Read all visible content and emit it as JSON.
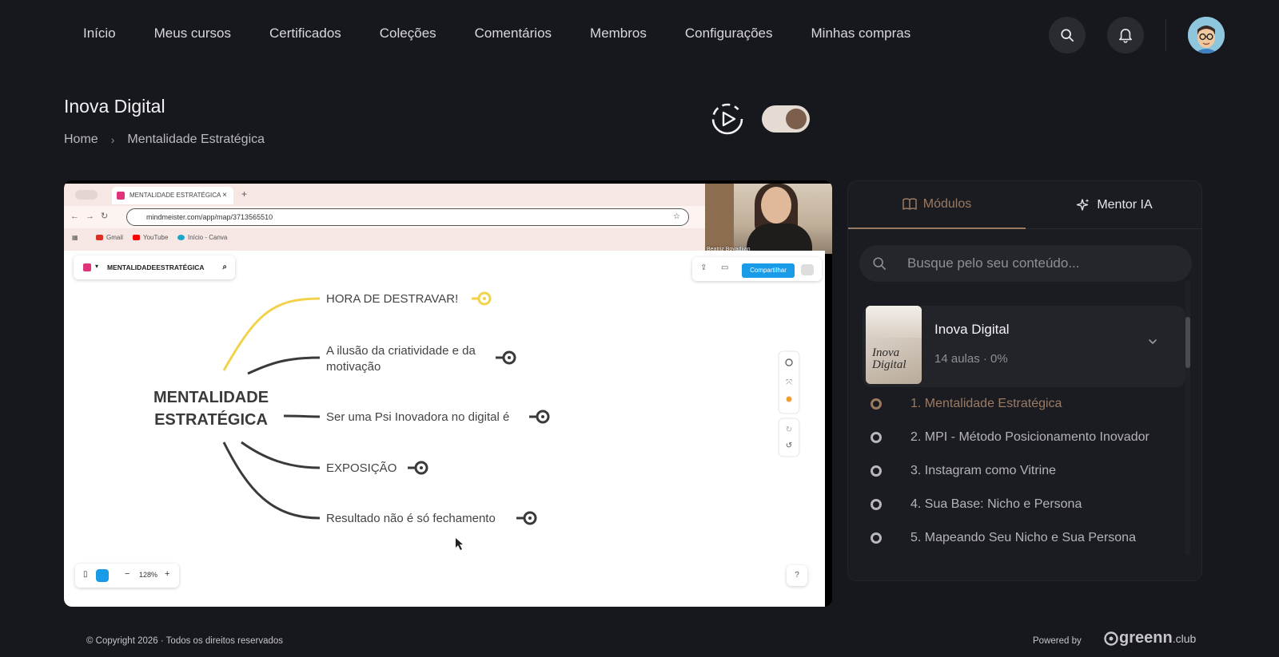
{
  "nav": {
    "items": [
      "Início",
      "Meus cursos",
      "Certificados",
      "Coleções",
      "Comentários",
      "Membros",
      "Configurações",
      "Minhas compras"
    ],
    "search_icon": "search-icon",
    "notification_icon": "bell-icon"
  },
  "header": {
    "title": "Inova Digital",
    "breadcrumb": {
      "home": "Home",
      "separator": "›",
      "current": "Mentalidade Estratégica"
    }
  },
  "video": {
    "browser_tab_title": "MENTALIDADE ESTRATÉGICA",
    "url": "mindmeister.com/app/map/3713565510",
    "bookmarks": [
      "Gmail",
      "YouTube",
      "Início - Canva"
    ],
    "webcam_name": "Beatriz Boyadjian",
    "map_title": "MENTALIDADEESTRATÉGICA",
    "share_label": "Compartilhar",
    "zoom": "128%",
    "central_topic": [
      "MENTALIDADE",
      "ESTRATÉGICA"
    ],
    "branches": [
      {
        "lines": [
          "HORA DE DESTRAVAR!"
        ],
        "color": "#f2d24a"
      },
      {
        "lines": [
          "A ilusão da criatividade e da",
          "motivação"
        ],
        "color": "#3a3a3a"
      },
      {
        "lines": [
          "Ser uma Psi Inovadora no digital é"
        ],
        "color": "#3a3a3a"
      },
      {
        "lines": [
          "EXPOSIÇÃO"
        ],
        "color": "#3a3a3a"
      },
      {
        "lines": [
          "Resultado não é só fechamento"
        ],
        "color": "#3a3a3a"
      }
    ]
  },
  "sidebar": {
    "tabs": {
      "modules": "Módulos",
      "mentor": "Mentor IA"
    },
    "search_placeholder": "Busque pelo seu conteúdo...",
    "module": {
      "title": "Inova Digital",
      "meta": "14 aulas · 0%",
      "thumb_text": [
        "Inova",
        "Digital"
      ]
    },
    "lessons": [
      "1. Mentalidade Estratégica",
      "2. MPI - Método Posicionamento Inovador",
      "3. Instagram como Vitrine",
      "4. Sua Base: Nicho e Persona",
      "5. Mapeando Seu Nicho e Sua Persona"
    ],
    "active_lesson": 0
  },
  "footer": {
    "copyright": "© Copyright 2026 · Todos os direitos reservados",
    "powered_by": "Powered by",
    "brand": "greenn",
    "brand_suffix": ".club"
  },
  "colors": {
    "accent": "#9b7a62",
    "background": "#17181d",
    "panel": "#1b1c21"
  }
}
